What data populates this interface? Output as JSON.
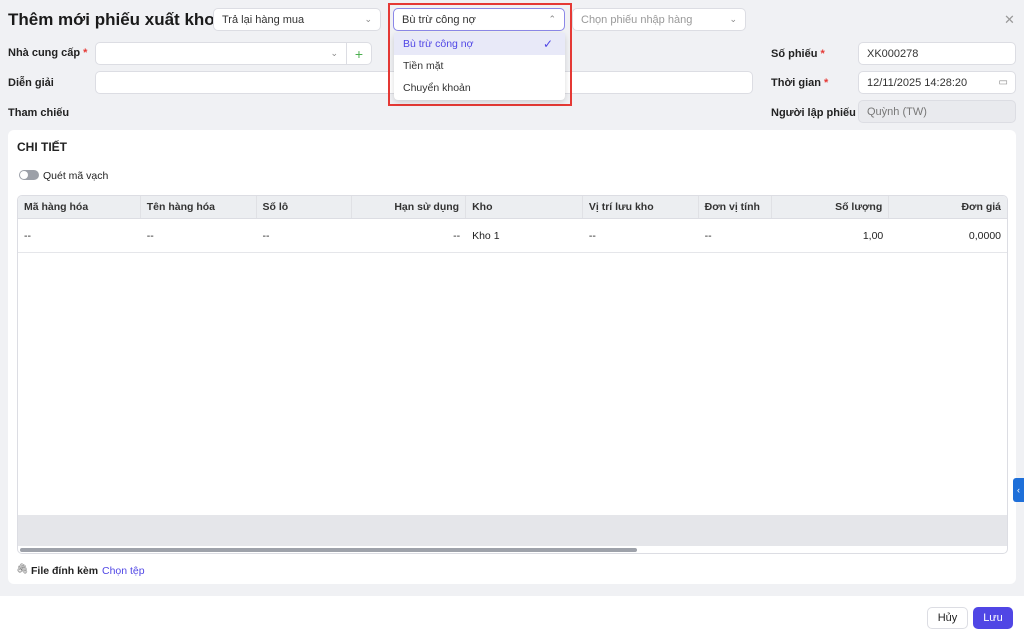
{
  "header": {
    "title": "Thêm mới phiếu xuất kho",
    "type_select": "Trả lại hàng mua",
    "payment_select": "Bù trừ công nợ",
    "import_select_placeholder": "Chọn phiếu nhập hàng"
  },
  "payment_menu": {
    "options": [
      {
        "label": "Bù trừ công nợ",
        "selected": true
      },
      {
        "label": "Tiền mặt",
        "selected": false
      },
      {
        "label": "Chuyển khoản",
        "selected": false
      }
    ]
  },
  "form": {
    "supplier_label": "Nhà cung cấp",
    "supplier_value": "",
    "description_label": "Diễn giải",
    "description_value": "",
    "reference_label": "Tham chiếu",
    "voucher_no_label": "Số phiếu",
    "voucher_no_value": "XK000278",
    "time_label": "Thời gian",
    "time_value": "12/11/2025 14:28:20",
    "creator_label": "Người lập phiếu",
    "creator_value": "Quỳnh (TW)",
    "required_mark": "*"
  },
  "detail": {
    "title": "CHI TIẾT",
    "barcode_toggle_label": "Quét mã vạch",
    "barcode_toggle_on": false,
    "columns": [
      "Mã hàng hóa",
      "Tên hàng hóa",
      "Số lô",
      "Hạn sử dụng",
      "Kho",
      "Vị trí lưu kho",
      "Đơn vị tính",
      "Số lượng",
      "Đơn giá"
    ],
    "rows": [
      [
        "--",
        "--",
        "--",
        "--",
        "Kho 1",
        "--",
        "--",
        "1,00",
        "0,0000"
      ]
    ]
  },
  "attachment": {
    "label": "File đính kèm",
    "choose_label": "Chọn tệp"
  },
  "footer": {
    "cancel_label": "Hủy",
    "save_label": "Lưu"
  },
  "colors": {
    "accent": "#5046e5",
    "highlight_border": "#e53935"
  }
}
